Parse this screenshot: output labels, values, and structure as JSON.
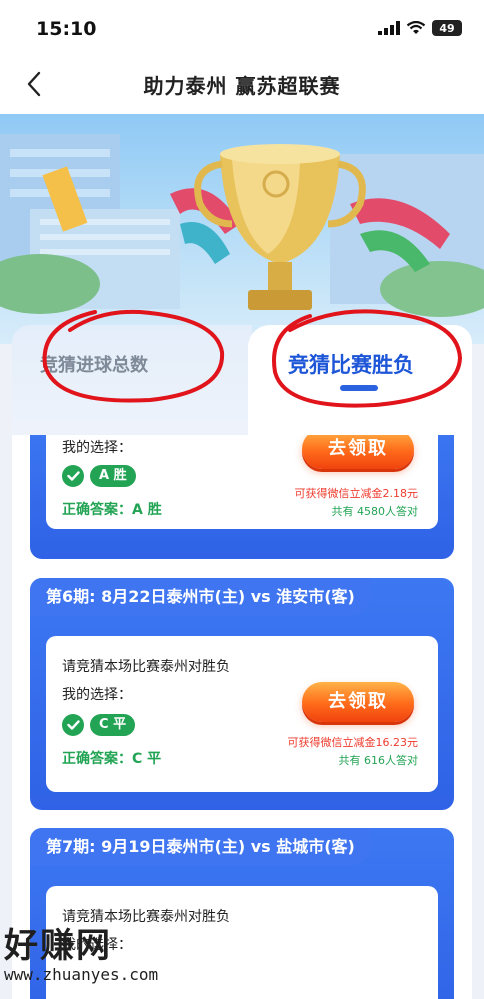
{
  "status_bar": {
    "time": "15:10",
    "battery": "49"
  },
  "nav": {
    "title": "助力泰州 赢苏超联赛"
  },
  "tabs": {
    "left": "竞猜进球总数",
    "right": "竞猜比赛胜负",
    "active": "right"
  },
  "cards": [
    {
      "header": "",
      "question": "",
      "my_choice_label": "我的选择：",
      "choice": "A 胜",
      "answer": "正确答案：A 胜",
      "claim_label": "去领取",
      "reward": "可获得微信立减金2.18元",
      "count": "共有 4580人答对"
    },
    {
      "header": "第6期: 8月22日泰州市(主) vs 淮安市(客)",
      "question": "请竞猜本场比赛泰州对胜负",
      "my_choice_label": "我的选择：",
      "choice": "C 平",
      "answer": "正确答案：C 平",
      "claim_label": "去领取",
      "reward": "可获得微信立减金16.23元",
      "count": "共有 616人答对"
    },
    {
      "header": "第7期: 9月19日泰州市(主) vs 盐城市(客)",
      "question": "请竞猜本场比赛泰州对胜负",
      "my_choice_label": "我的选择：",
      "choice": "",
      "answer": "",
      "claim_label": "",
      "reward": "",
      "count": ""
    }
  ],
  "watermark": {
    "brand": "好赚网",
    "url": "www.zhuanyes.com"
  },
  "colors": {
    "accent": "#2f62e6",
    "success": "#23a455",
    "warning": "#ee3b2d",
    "button": "#ff6a1a"
  }
}
